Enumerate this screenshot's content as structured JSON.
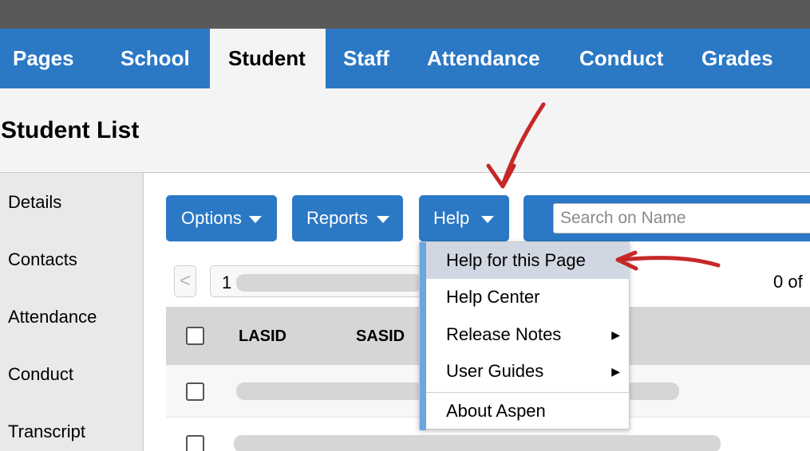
{
  "nav": {
    "tabs": [
      "Pages",
      "School",
      "Student",
      "Staff",
      "Attendance",
      "Conduct",
      "Grades"
    ],
    "active": "Student"
  },
  "page": {
    "title": "Student List"
  },
  "sidebar": {
    "items": [
      "Details",
      "Contacts",
      "Attendance",
      "Conduct",
      "Transcript"
    ]
  },
  "toolbar": {
    "options_label": "Options",
    "reports_label": "Reports",
    "help_label": "Help",
    "search_placeholder": "Search on Name"
  },
  "pager": {
    "prev": "<",
    "page_value": "1",
    "count_text": "0 of"
  },
  "table": {
    "columns": [
      "LASID",
      "SASID"
    ]
  },
  "help_menu": {
    "items": [
      "Help for this Page",
      "Help Center",
      "Release Notes",
      "User Guides",
      "About Aspen"
    ],
    "highlighted": "Help for this Page",
    "submenu_arrow": "▶"
  },
  "colors": {
    "brand_blue": "#2b78c5",
    "top_bar": "#595959",
    "annotation_red": "#c62828",
    "menu_highlight": "#d1d7e2"
  }
}
